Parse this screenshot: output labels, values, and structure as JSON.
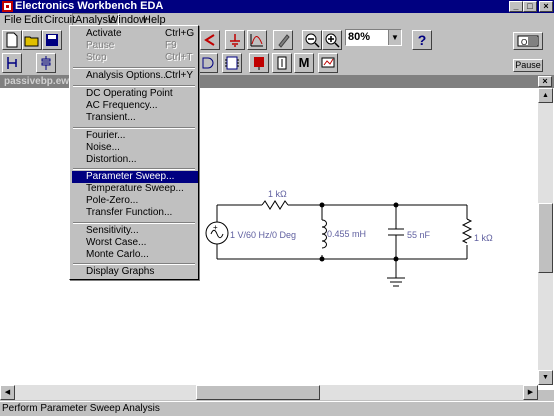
{
  "window": {
    "title": "Electronics Workbench EDA",
    "min": "_",
    "max": "□",
    "close": "×"
  },
  "menubar": {
    "items": [
      "File",
      "Edit",
      "Circuit",
      "Analysis",
      "Window",
      "Help"
    ]
  },
  "toolbar": {
    "zoom_value": "80%",
    "help_label": "?",
    "pause_label": "Pause",
    "m_label": "M"
  },
  "document": {
    "title": "passivebp.ewb",
    "close": "×"
  },
  "analysis_menu": {
    "items": [
      {
        "label": "Activate",
        "shortcut": "Ctrl+G",
        "disabled": false
      },
      {
        "label": "Pause",
        "shortcut": "F9",
        "disabled": true
      },
      {
        "label": "Stop",
        "shortcut": "Ctrl+T",
        "disabled": true
      },
      {
        "label": "Analysis Options...",
        "shortcut": "Ctrl+Y",
        "disabled": false
      },
      {
        "label": "DC Operating Point",
        "shortcut": "",
        "disabled": false
      },
      {
        "label": "AC Frequency...",
        "shortcut": "",
        "disabled": false
      },
      {
        "label": "Transient...",
        "shortcut": "",
        "disabled": false
      },
      {
        "label": "Fourier...",
        "shortcut": "",
        "disabled": false
      },
      {
        "label": "Noise...",
        "shortcut": "",
        "disabled": false
      },
      {
        "label": "Distortion...",
        "shortcut": "",
        "disabled": false
      },
      {
        "label": "Parameter Sweep...",
        "shortcut": "",
        "disabled": false,
        "highlighted": true
      },
      {
        "label": "Temperature Sweep...",
        "shortcut": "",
        "disabled": false
      },
      {
        "label": "Pole-Zero...",
        "shortcut": "",
        "disabled": false
      },
      {
        "label": "Transfer Function...",
        "shortcut": "",
        "disabled": false
      },
      {
        "label": "Sensitivity...",
        "shortcut": "",
        "disabled": false
      },
      {
        "label": "Worst Case...",
        "shortcut": "",
        "disabled": false
      },
      {
        "label": "Monte Carlo...",
        "shortcut": "",
        "disabled": false
      },
      {
        "label": "Display Graphs",
        "shortcut": "",
        "disabled": false
      }
    ]
  },
  "circuit": {
    "resistor_series": "1 kΩ",
    "source": "1 V/60 Hz/0 Deg",
    "inductor": "0.455 mH",
    "capacitor": "55 nF",
    "resistor_load": "1 kΩ"
  },
  "statusbar": {
    "text": "Perform Parameter Sweep Analysis"
  },
  "colors": {
    "titlebar": "#000080",
    "highlight": "#000080",
    "component_label": "#6060a0"
  }
}
